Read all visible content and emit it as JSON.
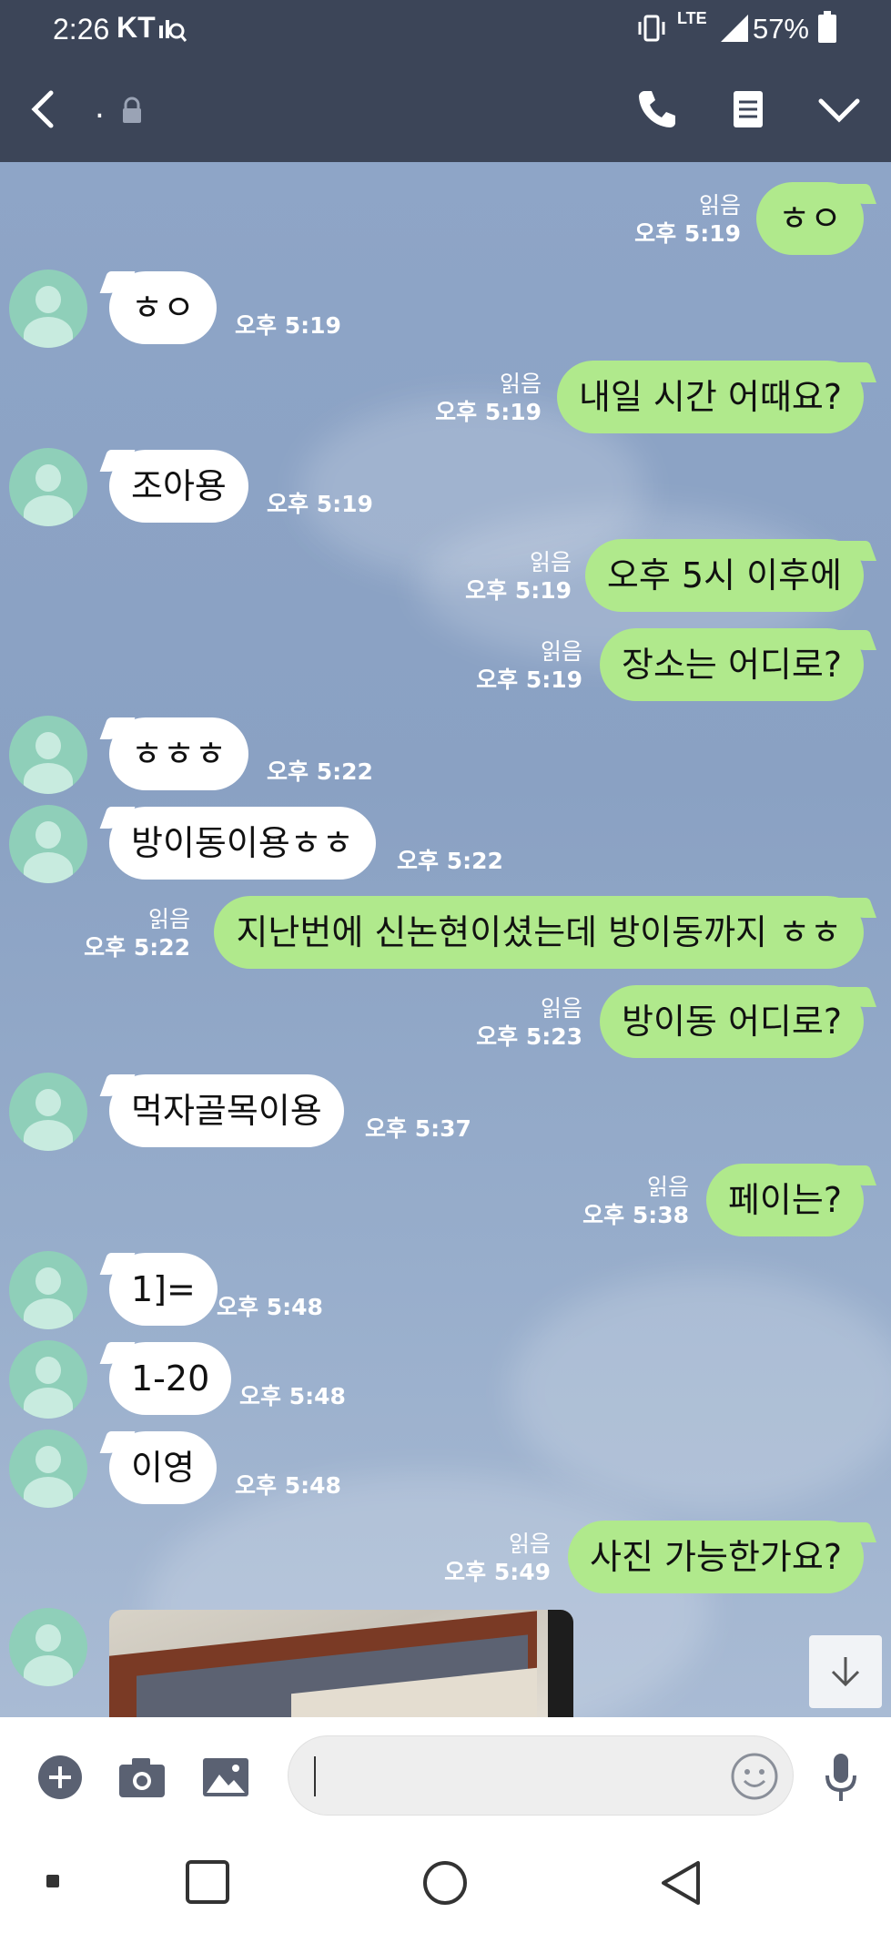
{
  "status_bar": {
    "time": "2:26",
    "carrier": "KT",
    "network": "LTE",
    "battery": "57%"
  },
  "header": {
    "title": ".",
    "icons": [
      "back-icon",
      "lock-icon",
      "phone-icon",
      "menu-icon",
      "chevron-down-icon"
    ]
  },
  "messages": [
    {
      "dir": "out",
      "text": "ㅎㅇ",
      "read": "읽음",
      "time": "오후 5:19"
    },
    {
      "dir": "in",
      "text": "ㅎㅇ",
      "time": "오후 5:19"
    },
    {
      "dir": "out",
      "text": "내일 시간 어때요?",
      "read": "읽음",
      "time": "오후 5:19"
    },
    {
      "dir": "in",
      "text": "조아용",
      "time": "오후 5:19"
    },
    {
      "dir": "out",
      "text": "오후 5시 이후에",
      "read": "읽음",
      "time": "오후 5:19"
    },
    {
      "dir": "out",
      "text": "장소는 어디로?",
      "read": "읽음",
      "time": "오후 5:19"
    },
    {
      "dir": "in",
      "text": "ㅎㅎㅎ",
      "time": "오후 5:22"
    },
    {
      "dir": "in",
      "text": "방이동이용ㅎㅎ",
      "time": "오후 5:22"
    },
    {
      "dir": "out",
      "text": "지난번에 신논현이셨는데 방이동까지 ㅎㅎ",
      "read": "읽음",
      "time": "오후 5:22"
    },
    {
      "dir": "out",
      "text": "방이동 어디로?",
      "read": "읽음",
      "time": "오후 5:23"
    },
    {
      "dir": "in",
      "text": "먹자골목이용",
      "time": "오후 5:37"
    },
    {
      "dir": "out",
      "text": "페이는?",
      "read": "읽음",
      "time": "오후 5:38"
    },
    {
      "dir": "in",
      "text": "1]=",
      "time": "오후 5:48"
    },
    {
      "dir": "in",
      "text": "1-20",
      "time": "오후 5:48"
    },
    {
      "dir": "in",
      "text": "이영",
      "time": "오후 5:48"
    },
    {
      "dir": "out",
      "text": "사진 가능한가요?",
      "read": "읽음",
      "time": "오후 5:49"
    }
  ],
  "input": {
    "value": "",
    "placeholder": ""
  },
  "colors": {
    "header": "#3c4558",
    "chat_background": "#8aa1c4",
    "outgoing_bubble": "#b0e98c",
    "incoming_bubble": "#ffffff",
    "avatar": "#8fcfb9"
  }
}
